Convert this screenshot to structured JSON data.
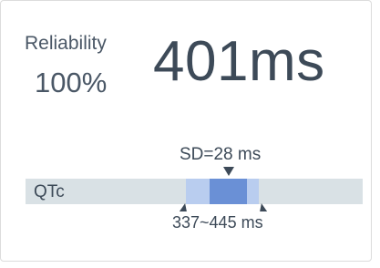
{
  "reliability": {
    "label": "Reliability",
    "value": "100%"
  },
  "measurement": {
    "value": "401ms"
  },
  "interval": {
    "track_label": "QTc",
    "sd_label": "SD=28 ms",
    "range_label": "337~445 ms"
  },
  "colors": {
    "track": "#d9e1e5",
    "range": "#b9cdef",
    "sd": "#6a90d6",
    "text": "#3d4a58"
  }
}
